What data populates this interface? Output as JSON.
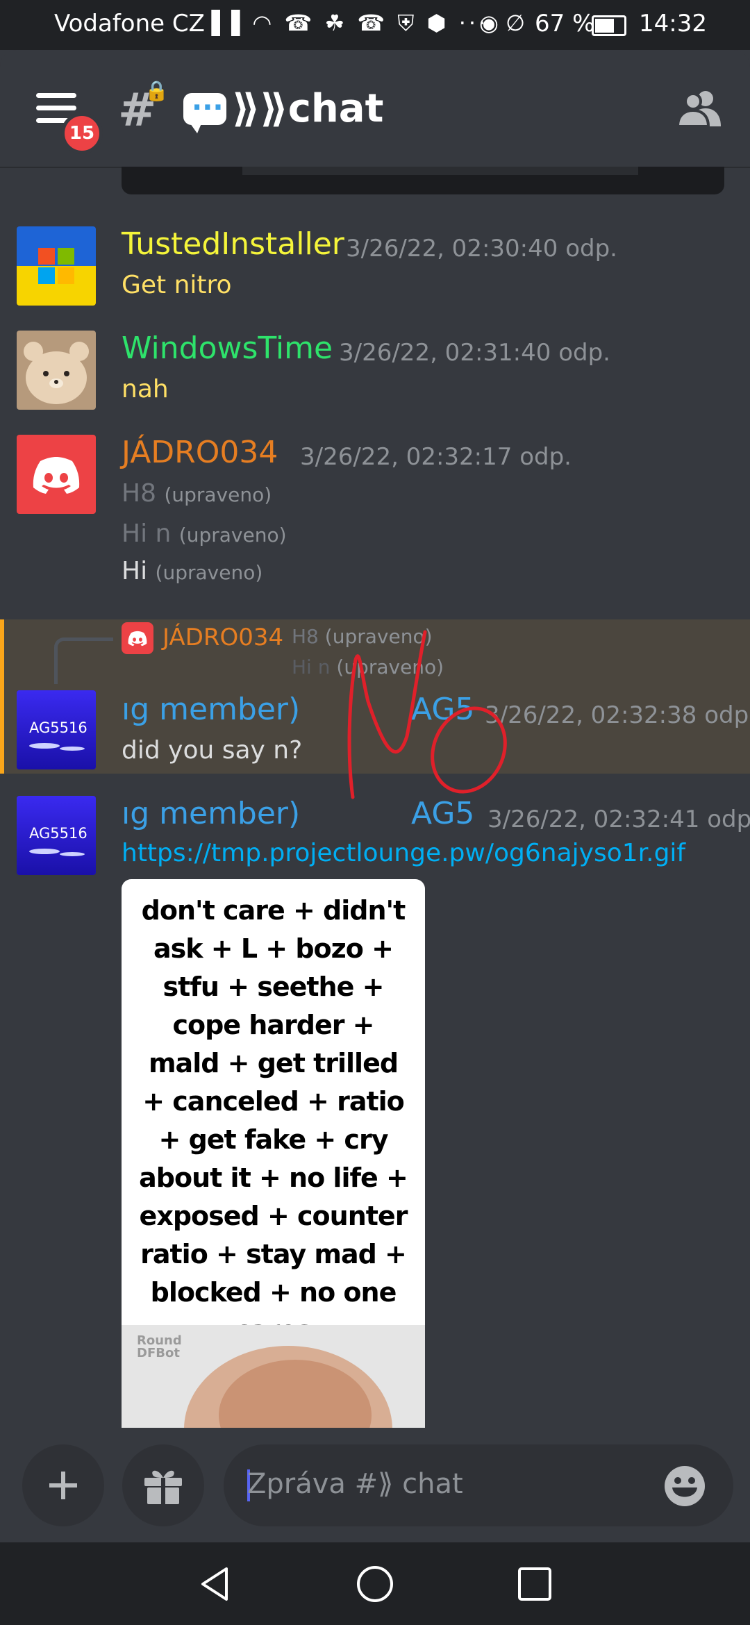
{
  "status_bar": {
    "carrier": "Vodafone CZ",
    "signal_icons": "▐▐ ◠ ☎ ☘ ☎ ⛨ ⬢ ···",
    "right_icons": "◉ ∅",
    "battery": "67 %",
    "battery_level": 0.67,
    "time": "14:32"
  },
  "header": {
    "badge_count": "15",
    "channel_name": "⟫⟫chat",
    "channel_icon": "hashtag-lock-icon",
    "menu_icon": "hamburger-menu-icon",
    "members_icon": "members-icon"
  },
  "messages": [
    {
      "username": "TustedInstaller",
      "color": "#f5f53a",
      "timestamp": "3/26/22, 02:30:40 odp.",
      "lines": [
        {
          "text": "Get nitro",
          "edited": ""
        }
      ]
    },
    {
      "username": "WindowsTime",
      "color": "#2ee36b",
      "timestamp": "3/26/22, 02:31:40 odp.",
      "lines": [
        {
          "text": "nah",
          "edited": ""
        }
      ]
    },
    {
      "username": "JÁDRO034",
      "color": "#e67e22",
      "timestamp": "3/26/22, 02:32:17 odp.",
      "lines": [
        {
          "text": "H8",
          "edited": "(upraveno)"
        },
        {
          "text": "Hi n",
          "edited": "(upraveno)"
        },
        {
          "text": "Hi",
          "edited": "(upraveno)"
        }
      ]
    }
  ],
  "reply": {
    "referenced_user": "JÁDRO034",
    "referenced_line1": "H8",
    "referenced_line2": "Hi n",
    "edited": "(upraveno)",
    "username": "ıg member)",
    "username_tail": "AG5",
    "timestamp": "3/26/22, 02:32:38 odp.",
    "text": "did you say n?",
    "avatar_label": "AG5516"
  },
  "last_message": {
    "username": "ıg member)",
    "username_tail": "AG5",
    "timestamp": "3/26/22, 02:32:41 odp.",
    "link": "https://tmp.projectlounge.pw/og6najyso1r.gif",
    "avatar_label": "AG5516",
    "gif_text": "don't care + didn't ask + L + bozo + stfu + seethe + cope harder + mald + get trilled + canceled + ratio + get fake + cry about it + no life + exposed + counter ratio + stay mad + blocked + no one cares",
    "gif_watermark": "Round DFBot"
  },
  "annotation": "No",
  "composer": {
    "placeholder": "Zpráva #⟫ chat",
    "add_icon": "plus-icon",
    "gift_icon": "gift-icon",
    "emoji_icon": "emoji-icon"
  },
  "colors": {
    "background": "#36393f",
    "link": "#00aff4",
    "reply_highlight": "#4b463e",
    "reply_border": "#faa61a",
    "badge": "#ed4245",
    "member_name": "#3ba0e6",
    "annotation": "#e0202a"
  }
}
